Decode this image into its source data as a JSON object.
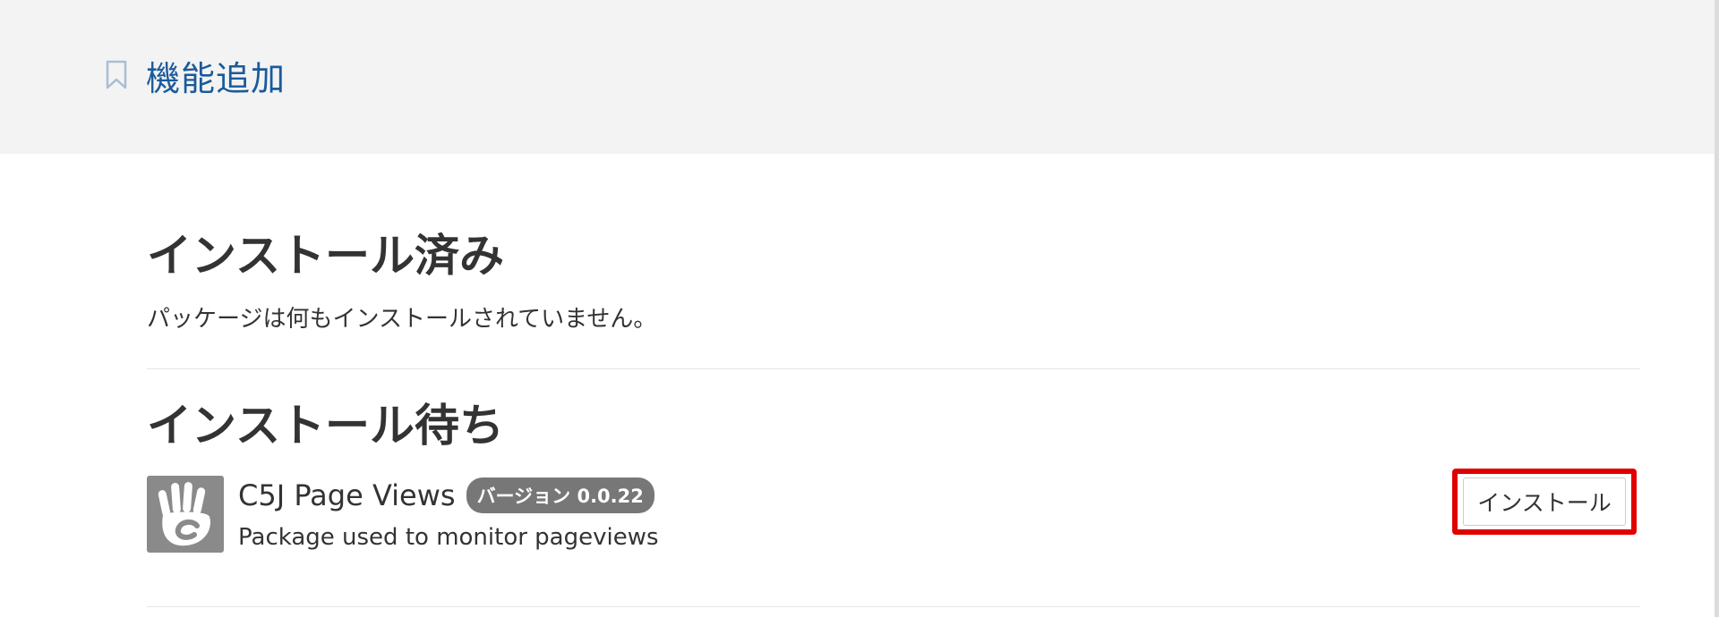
{
  "header": {
    "title": "機能追加",
    "icon": "bookmark-icon"
  },
  "installed": {
    "heading": "インストール済み",
    "empty_message": "パッケージは何もインストールされていません。"
  },
  "pending": {
    "heading": "インストール待ち",
    "packages": [
      {
        "name": "C5J Page Views",
        "version_badge": "バージョン 0.0.22",
        "description": "Package used to monitor pageviews",
        "install_label": "インストール",
        "icon": "concrete5-hand-logo-icon"
      }
    ]
  },
  "colors": {
    "title_blue": "#1a5a9c",
    "header_bg": "#f3f3f3",
    "badge_bg": "#777777",
    "highlight_red": "#e00000"
  }
}
